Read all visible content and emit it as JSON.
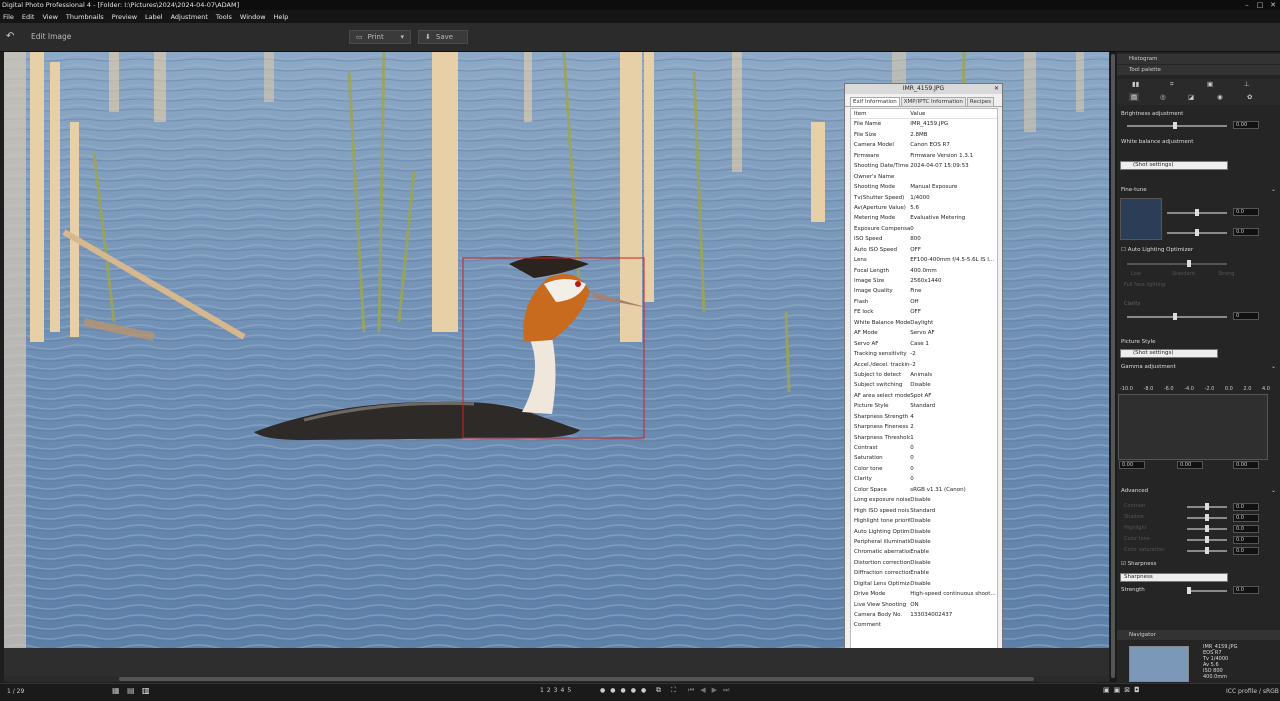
{
  "window": {
    "title": "Digital Photo Professional 4 - [Folder: I:\\Pictures\\2024\\2024-04-07\\ADAM]"
  },
  "menu": [
    "File",
    "Edit",
    "View",
    "Thumbnails",
    "Preview",
    "Label",
    "Adjustment",
    "Tools",
    "Window",
    "Help"
  ],
  "toolbar": {
    "edit_image_label": "Edit Image",
    "print_label": "Print",
    "save_label": "Save"
  },
  "status": {
    "page_counter": "1 / 29",
    "color_profile": "ICC profile / sRGB"
  },
  "bottom_bar": {
    "rating_labels": [
      "1",
      "2",
      "3",
      "4",
      "5"
    ]
  },
  "exif_dialog": {
    "title": "IMR_4159.JPG",
    "tabs": [
      "Exif Information",
      "XMP/IPTC Information",
      "Recipes"
    ],
    "columns": [
      "Item",
      "Value"
    ],
    "rows": [
      [
        "File Name",
        "IMR_4159.JPG"
      ],
      [
        "File Size",
        "2.8MB"
      ],
      [
        "Camera Model",
        "Canon EOS R7"
      ],
      [
        "Firmware",
        "Firmware Version 1.3.1"
      ],
      [
        "Shooting Date/Time",
        "2024-04-07 15:09:53"
      ],
      [
        "Owner's Name",
        ""
      ],
      [
        "Shooting Mode",
        "Manual Exposure"
      ],
      [
        "Tv(Shutter Speed)",
        "1/4000"
      ],
      [
        "Av(Aperture Value)",
        "5.6"
      ],
      [
        "Metering Mode",
        "Evaluative Metering"
      ],
      [
        "Exposure Compensati...",
        "0"
      ],
      [
        "ISO Speed",
        "800"
      ],
      [
        "Auto ISO Speed",
        "OFF"
      ],
      [
        "Lens",
        "EF100-400mm f/4.5-5.6L IS I..."
      ],
      [
        "Focal Length",
        "400.0mm"
      ],
      [
        "Image Size",
        "2560x1440"
      ],
      [
        "Image Quality",
        "Fine"
      ],
      [
        "Flash",
        "Off"
      ],
      [
        "FE lock",
        "OFF"
      ],
      [
        "White Balance Mode",
        "Daylight"
      ],
      [
        "AF Mode",
        "Servo AF"
      ],
      [
        "Servo AF",
        "Case 1"
      ],
      [
        "Tracking sensitivity",
        "-2"
      ],
      [
        "Accel./decel. tracking",
        "-2"
      ],
      [
        "Subject to detect",
        "Animals"
      ],
      [
        "Subject switching",
        "Disable"
      ],
      [
        "AF area select mode",
        "Spot AF"
      ],
      [
        "Picture Style",
        "Standard"
      ],
      [
        "Sharpness Strength",
        "4"
      ],
      [
        "Sharpness Fineness",
        "2"
      ],
      [
        "Sharpness Threshold",
        "1"
      ],
      [
        "Contrast",
        "0"
      ],
      [
        "Saturation",
        "0"
      ],
      [
        "Color tone",
        "0"
      ],
      [
        "Clarity",
        "0"
      ],
      [
        "Color Space",
        "sRGB v1.31 (Canon)"
      ],
      [
        "Long exposure noise ...",
        "Disable"
      ],
      [
        "High ISO speed nois...",
        "Standard"
      ],
      [
        "Highlight tone priority",
        "Disable"
      ],
      [
        "Auto Lighting Optimizer",
        "Disable"
      ],
      [
        "Peripheral illumination...",
        "Disable"
      ],
      [
        "Chromatic aberration ...",
        "Enable"
      ],
      [
        "Distortion correction",
        "Disable"
      ],
      [
        "Diffraction correction",
        "Enable"
      ],
      [
        "Digital Lens Optimizer",
        "Disable"
      ],
      [
        "Drive Mode",
        "High-speed continuous shoot..."
      ],
      [
        "Live View Shooting",
        "ON"
      ],
      [
        "Camera Body No.",
        "133034002437"
      ],
      [
        "Comment",
        ""
      ]
    ]
  },
  "right_panel": {
    "histogram_label": "Histogram",
    "tool_palette_label": "Tool palette",
    "brightness_label": "Brightness adjustment",
    "brightness_value": "0.00",
    "white_balance_label": "White balance adjustment",
    "wb_select": "(Shot settings)",
    "fine_tune_label": "Fine-tune",
    "fine_tune_values": [
      "0.0",
      "0.0"
    ],
    "alo_label": "Auto Lighting Optimizer",
    "alo_levels": [
      "Low",
      "Standard",
      "Strong"
    ],
    "face_lighting_label": "Full face lighting",
    "clarity_label": "Clarity",
    "clarity_value": "0",
    "picture_style_label": "Picture Style",
    "picture_style_select": "(Shot settings)",
    "gamma_label": "Gamma adjustment",
    "gamma_scale": [
      "-10.0",
      "-8.0",
      "-6.0",
      "-4.0",
      "-2.0",
      "0.0",
      "2.0",
      "4.0"
    ],
    "gamma_values": [
      "0.00",
      "0.00",
      "0.00"
    ],
    "advanced_label": "Advanced",
    "advanced_items": [
      "Contrast",
      "Shadow",
      "Highlight",
      "Color tone",
      "Color saturation"
    ],
    "advanced_values": [
      "0.0",
      "0.0",
      "0.0",
      "0.0",
      "0.0"
    ],
    "sharpness_checkbox_label": "Sharpness",
    "sharpness_select": "Sharpness",
    "strength_label": "Strength",
    "strength_value": "0.0",
    "navigator_label": "Navigator",
    "navigator_info": [
      "IMR_4159.JPG",
      "EOS R7",
      "Tv 1/4000",
      "Av 5.6",
      "ISO 800",
      "400.0mm"
    ]
  },
  "colors": {
    "accent": "#2a6fd6",
    "focus_box": "#cc2222",
    "water": "#6d8fb5"
  }
}
